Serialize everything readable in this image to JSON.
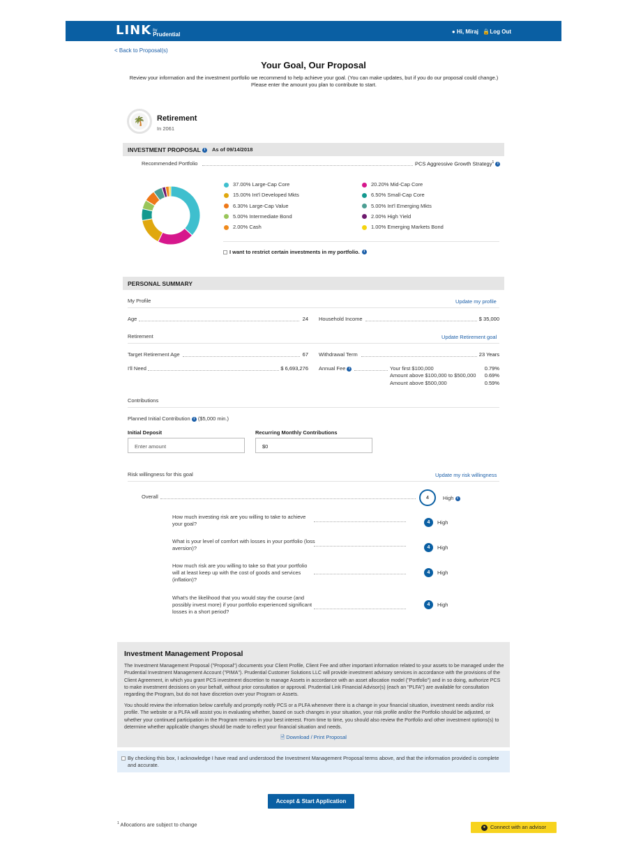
{
  "header": {
    "logo_text": "LINK",
    "logo_by": "by",
    "logo_company": "Prudential",
    "user_greeting": "Hi, Miraj",
    "logout_label": "Log Out"
  },
  "nav": {
    "back_label": "< Back to Proposal(s)"
  },
  "page": {
    "title": "Your Goal, Our Proposal",
    "intro_line1": "Review your information and the investment portfolio we recommend to help achieve your goal. (You can make updates, but if you do our proposal could change.)",
    "intro_line2": "Please enter the amount you plan to contribute to start."
  },
  "goal": {
    "name": "Retirement",
    "year": "In 2061"
  },
  "investment_proposal": {
    "title": "INVESTMENT PROPOSAL",
    "as_of": "As of 09/14/2018",
    "recommended_label": "Recommended Portfolio",
    "recommended_value": "PCS Aggressive Growth Strategy",
    "recommended_sup": "1",
    "restrict_label": "I want to restrict certain investments in my portfolio.",
    "allocations": [
      {
        "label": "37.00% Large-Cap Core",
        "value": 37.0,
        "color": "#3fbfce"
      },
      {
        "label": "20.20% Mid-Cap Core",
        "value": 20.2,
        "color": "#d6178c"
      },
      {
        "label": "15.00% Int'l Developed Mkts",
        "value": 15.0,
        "color": "#e0a80f"
      },
      {
        "label": "6.50% Small-Cap Core",
        "value": 6.5,
        "color": "#13998f"
      },
      {
        "label": "6.30% Large-Cap Value",
        "value": 6.3,
        "color": "#ee7818"
      },
      {
        "label": "5.00% Int'l Emerging Mkts",
        "value": 5.0,
        "color": "#4c9e93"
      },
      {
        "label": "5.00% Intermediate Bond",
        "value": 5.0,
        "color": "#99c55a"
      },
      {
        "label": "2.00% High Yield",
        "value": 2.0,
        "color": "#6e1a6e"
      },
      {
        "label": "2.00% Cash",
        "value": 2.0,
        "color": "#f08a1c"
      },
      {
        "label": "1.00% Emerging Markets Bond",
        "value": 1.0,
        "color": "#f5d40f"
      }
    ]
  },
  "personal_summary": {
    "title": "PERSONAL SUMMARY",
    "my_profile": "My Profile",
    "update_profile": "Update my profile",
    "age_label": "Age",
    "age_value": "24",
    "income_label": "Household Income",
    "income_value": "$ 35,000",
    "retirement_label": "Retirement",
    "update_retirement": "Update Retirement goal",
    "target_age_label": "Target Retirement Age",
    "target_age_value": "67",
    "withdrawal_label": "Withdrawal Term",
    "withdrawal_value": "23 Years",
    "need_label": "I'll Need",
    "need_value": "$ 6,693,276",
    "fee_label": "Annual Fee",
    "fees": [
      {
        "label": "Your first $100,000",
        "value": "0.79%"
      },
      {
        "label": "Amount above $100,000 to $500,000",
        "value": "0.69%"
      },
      {
        "label": "Amount above $500,000",
        "value": "0.59%"
      }
    ],
    "contributions_label": "Contributions",
    "planned_label": "Planned Initial Contribution",
    "planned_min": "($5,000 min.)",
    "initial_deposit_label": "Initial Deposit",
    "initial_deposit_placeholder": "Enter amount",
    "recurring_label": "Recurring Monthly Contributions",
    "recurring_value": "$0"
  },
  "risk": {
    "title": "Risk willingness for this goal",
    "update_label": "Update my risk willingness",
    "overall_label": "Overall",
    "overall_score": "4",
    "overall_level": "High",
    "questions": [
      {
        "text": "How much investing risk are you willing to take to achieve your goal?",
        "score": "4",
        "level": "High"
      },
      {
        "text": "What is your level of comfort with losses in your portfolio (loss aversion)?",
        "score": "4",
        "level": "High"
      },
      {
        "text": "How much risk are you willing to take so that your portfolio will at least keep up with the cost of goods and services (inflation)?",
        "score": "4",
        "level": "High"
      },
      {
        "text": "What's the likelihood that you would stay the course (and possibly invest more) if your portfolio experienced significant losses in a short period?",
        "score": "4",
        "level": "High"
      }
    ]
  },
  "imp": {
    "title": "Investment Management Proposal",
    "para1": "The Investment Management Proposal (\"Proposal\") documents your Client Profile, Client Fee and other important information related to your assets to be managed under the Prudential Investment Management Account (\"PIMA\"). Prudential Customer Solutions LLC will provide investment advisory services in accordance with the provisions of the Client Agreement, in which you grant PCS investment discretion to manage Assets in accordance with an asset allocation model (\"Portfolio\") and in so doing, authorize PCS to make investment decisions on your behalf, without prior consultation or approval. Prudential Link Financial Advisor(s) (each an \"PLFA\") are available for consultation regarding the Program, but do not have discretion over your Program or Assets.",
    "para2": "You should review the information below carefully and promptly notify PCS or a PLFA whenever there is a change in your financial situation, investment needs and/or risk profile. The website or a PLFA will assist you in evaluating whether, based on such changes in your situation, your risk profile and/or the Portfolio should be adjusted, or whether your continued participation in the Program remains in your best interest. From time to time, you should also review the Portfolio and other investment options(s) to determine whether applicable changes should be made to reflect your financial situation and needs.",
    "download_label": "Download / Print Proposal"
  },
  "acknowledge": {
    "text": "By checking this box, I acknowledge I have read and understood the Investment Management Proposal terms above, and that the information provided is complete and accurate."
  },
  "actions": {
    "accept_label": "Accept & Start Application",
    "footnote_sup": "1",
    "footnote": "Allocations are subject to change",
    "connect_label": "Connect with an advisor"
  }
}
